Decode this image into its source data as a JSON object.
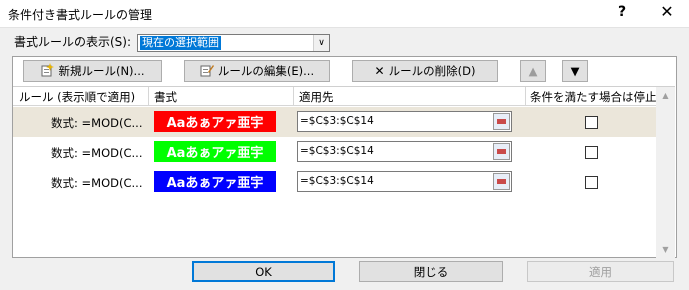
{
  "window": {
    "title": "条件付き書式ルールの管理",
    "help_glyph": "?",
    "close_glyph": "✕"
  },
  "show_rules": {
    "label": "書式ルールの表示(S):",
    "selected": "現在の選択範囲",
    "dropdown_glyph": "∨"
  },
  "toolbar": {
    "new_label": "新規ルール(N)...",
    "edit_label": "ルールの編集(E)...",
    "delete_label": "ルールの削除(D)",
    "delete_glyph": "✕",
    "up_glyph": "▲",
    "down_glyph": "▼"
  },
  "columns": {
    "rule": "ルール (表示順で適用)",
    "format": "書式",
    "applies_to": "適用先",
    "stop_if_true": "条件を満たす場合は停止"
  },
  "rules": [
    {
      "name": "数式: =MOD(C...",
      "preview": "Aaあぁアァ亜宇",
      "color": "#ff0000",
      "applies_to": "=$C$3:$C$14",
      "stop": false
    },
    {
      "name": "数式: =MOD(C...",
      "preview": "Aaあぁアァ亜宇",
      "color": "#00ff00",
      "applies_to": "=$C$3:$C$14",
      "stop": false
    },
    {
      "name": "数式: =MOD(C...",
      "preview": "Aaあぁアァ亜宇",
      "color": "#0000ff",
      "applies_to": "=$C$3:$C$14",
      "stop": false
    }
  ],
  "buttons": {
    "ok": "OK",
    "close": "閉じる",
    "apply": "適用"
  },
  "colors": {
    "selected_row": "#ebe6da",
    "focus": "#0078d7"
  }
}
